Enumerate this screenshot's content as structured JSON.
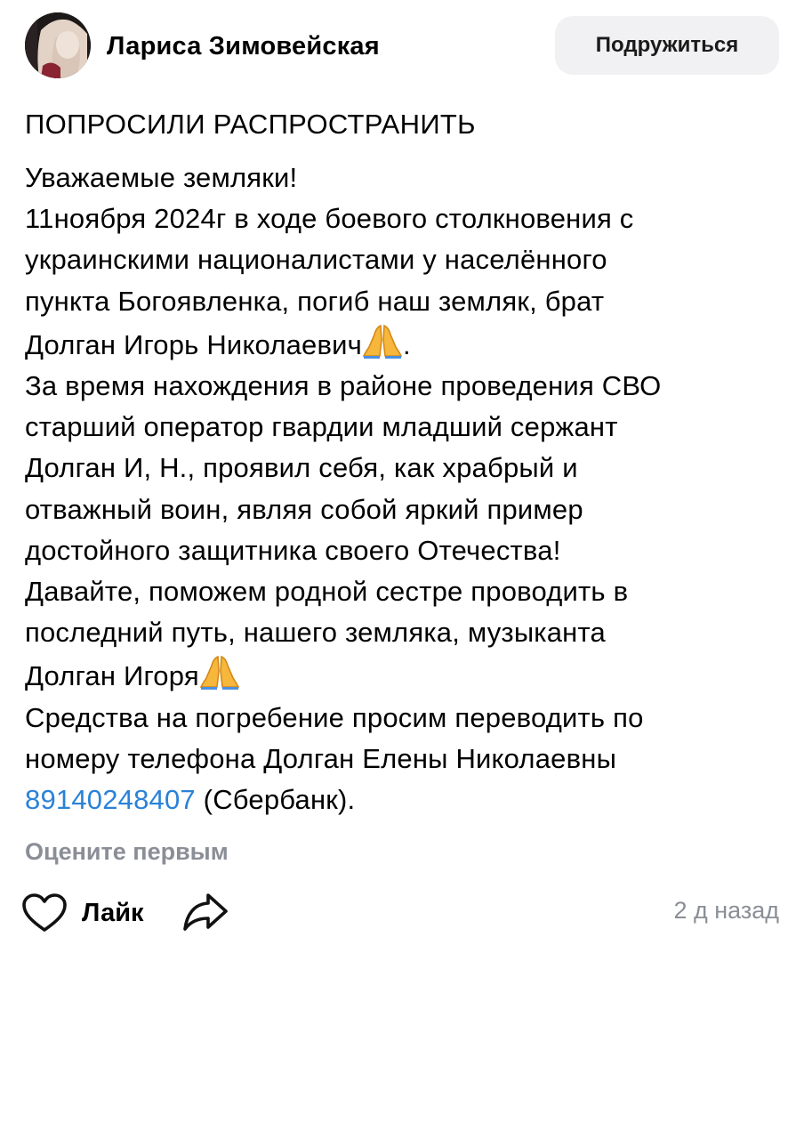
{
  "post": {
    "author": {
      "name": "Лариса Зимовейская",
      "avatar": "profile-photo"
    },
    "friend_button": "Подружиться",
    "title": "ПОПРОСИЛИ РАСПРОСТРАНИТЬ",
    "body_lines": [
      "Уважаемые земляки!",
      "11ноября 2024г в ходе боевого столкновения с",
      "украинскими националистами у населённого",
      "пункта Богоявленка, погиб наш земляк, брат",
      "Долган Игорь Николаевич",
      ".",
      "За время нахождения в районе проведения СВО",
      "старший оператор гвардии младший сержант",
      "Долган И, Н., проявил себя,  как храбрый и",
      "отважный воин, являя собой яркий пример",
      "достойного защитника своего Отечества!",
      "Давайте, поможем родной сестре проводить в",
      "последний путь, нашего земляка, музыканта",
      "Долган Игоря",
      "Средства на погребение просим переводить по",
      "номеру телефона Долган Елены Николаевны",
      "89140248407",
      " (Сбербанк)."
    ],
    "emoji_icon": "folded-hands-emoji",
    "rate_prompt": "Оцените первым",
    "like_label": "Лайк",
    "time_ago": "2 д назад",
    "colors": {
      "link": "#2a82d8",
      "muted": "#8a8e96",
      "button_bg": "#f1f1f3"
    }
  }
}
